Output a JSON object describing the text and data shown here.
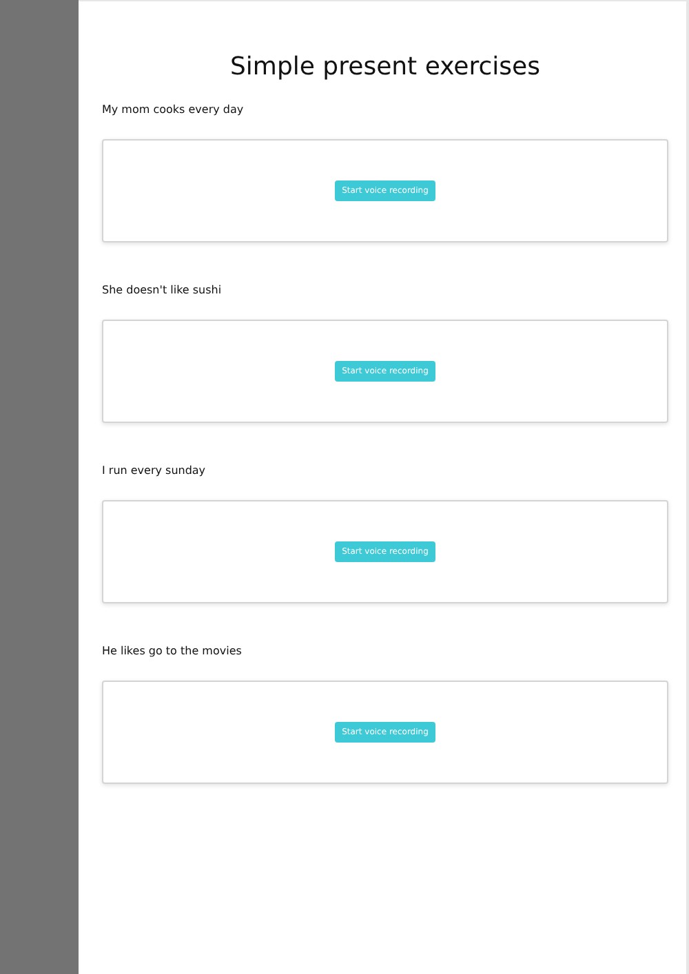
{
  "title": "Simple present exercises",
  "exercises": [
    {
      "prompt": "My mom cooks every day",
      "button": "Start voice recording"
    },
    {
      "prompt": "She doesn't like sushi",
      "button": "Start voice recording"
    },
    {
      "prompt": "I run every sunday",
      "button": "Start voice recording"
    },
    {
      "prompt": "He likes go to the movies",
      "button": "Start voice recording"
    }
  ]
}
